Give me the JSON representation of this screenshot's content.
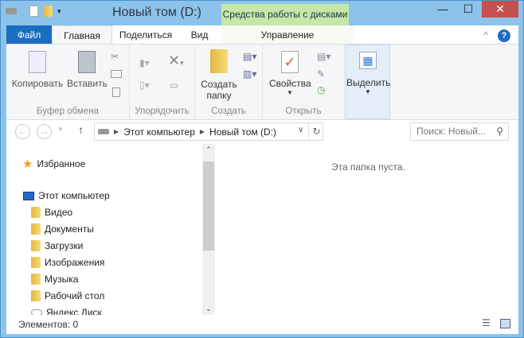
{
  "window": {
    "title": "Новый том (D:)",
    "context_tab": "Средства работы с дисками",
    "minimize": "—",
    "maximize": "☐",
    "close": "✕"
  },
  "tabs": [
    {
      "label": "Файл"
    },
    {
      "label": "Главная"
    },
    {
      "label": "Поделиться"
    },
    {
      "label": "Вид"
    },
    {
      "label": "Управление"
    }
  ],
  "ribbon": {
    "clipboard": {
      "label": "Буфер обмена",
      "copy": "Копировать",
      "paste": "Вставить"
    },
    "organize": {
      "label": "Упорядочить"
    },
    "create": {
      "label": "Создать",
      "new_folder_line1": "Создать",
      "new_folder_line2": "папку"
    },
    "open": {
      "label": "Открыть",
      "properties": "Свойства"
    },
    "select": {
      "label": "Выделить"
    }
  },
  "address": {
    "crumbs": [
      "Этот компьютер",
      "Новый том (D:)"
    ],
    "search_placeholder": "Поиск: Новый..."
  },
  "nav": {
    "favorites": "Избранное",
    "computer": "Этот компьютер",
    "items": [
      "Видео",
      "Документы",
      "Загрузки",
      "Изображения",
      "Музыка",
      "Рабочий стол",
      "Яндекс.Диск"
    ]
  },
  "main": {
    "empty_text": "Эта папка пуста."
  },
  "status": {
    "items": "Элементов: 0"
  }
}
